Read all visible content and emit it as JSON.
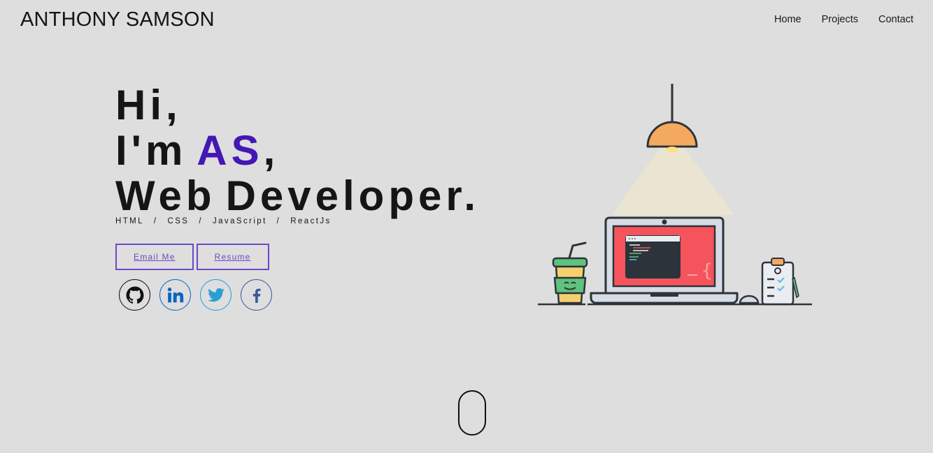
{
  "header": {
    "brand": "ANTHONY SAMSON",
    "nav": [
      "Home",
      "Projects",
      "Contact"
    ]
  },
  "hero": {
    "line1": "Hi,",
    "line2_prefix": "I'm",
    "line2_accent": "AS",
    "line2_suffix": ",",
    "line3_a": "Web",
    "line3_b": "Developer.",
    "skills": [
      "HTML",
      "CSS",
      "JavaScript",
      "ReactJs"
    ],
    "skills_separator": "/",
    "buttons": {
      "email": "Email Me",
      "resume": "Resume"
    },
    "socials": [
      "github-icon",
      "linkedin-icon",
      "twitter-icon",
      "facebook-icon"
    ]
  },
  "colors": {
    "background": "#dedede",
    "accent": "#4417b4",
    "button_border": "#6a4ac4",
    "linkedin": "#0a66c2",
    "twitter": "#2a9fd6",
    "facebook": "#3b5998"
  }
}
